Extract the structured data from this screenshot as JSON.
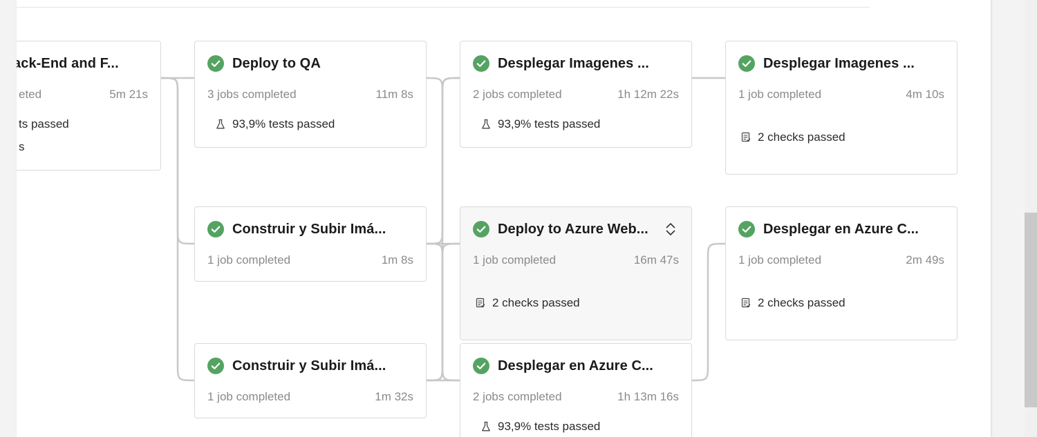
{
  "stages": {
    "backend": {
      "title": "ack-End and F...",
      "status": "eted",
      "duration": "5m 21s",
      "tests": "ts passed",
      "checks": "s"
    },
    "deploy_qa": {
      "title": "Deploy to QA",
      "status": "3 jobs completed",
      "duration": "11m 8s",
      "tests": "93,9% tests passed"
    },
    "desplegar_imagenes_1": {
      "title": "Desplegar Imagenes ...",
      "status": "2 jobs completed",
      "duration": "1h 12m 22s",
      "tests": "93,9% tests passed"
    },
    "desplegar_imagenes_2": {
      "title": "Desplegar Imagenes ...",
      "status": "1 job completed",
      "duration": "4m 10s",
      "checks": "2 checks passed"
    },
    "construir_1": {
      "title": "Construir y Subir Imá...",
      "status": "1 job completed",
      "duration": "1m 8s"
    },
    "deploy_azure_web": {
      "title": "Deploy to Azure Web...",
      "status": "1 job completed",
      "duration": "16m 47s",
      "checks": "2 checks passed"
    },
    "desplegar_azure_c_1": {
      "title": "Desplegar en Azure C...",
      "status": "1 job completed",
      "duration": "2m 49s",
      "checks": "2 checks passed"
    },
    "construir_2": {
      "title": "Construir y Subir Imá...",
      "status": "1 job completed",
      "duration": "1m 32s"
    },
    "desplegar_azure_c_2": {
      "title": "Desplegar en Azure C...",
      "status": "2 jobs completed",
      "duration": "1h 13m 16s",
      "tests": "93,9% tests passed"
    }
  },
  "icons": {
    "success": "check-circle-icon",
    "tests": "beaker-icon",
    "checks": "checklist-icon",
    "expand": "chevron-up-down-icon"
  },
  "colors": {
    "success": "#55a362",
    "connector": "#c8c8c8",
    "card_border": "#dadada",
    "muted_text": "#8a8a8a",
    "hover_bg": "#f7f7f7"
  }
}
